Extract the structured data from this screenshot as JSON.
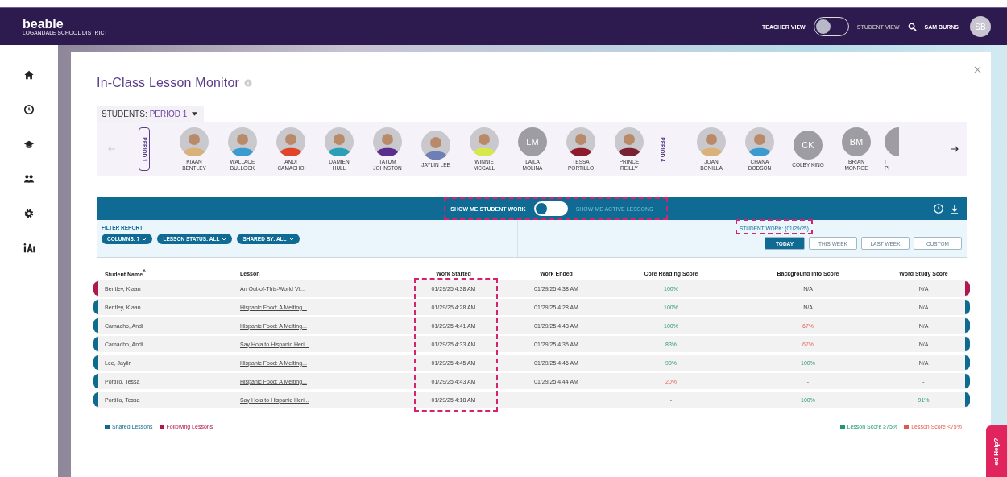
{
  "header": {
    "logo": "beable",
    "district": "LOGANDALE SCHOOL DISTRICT",
    "view_toggle": {
      "left_label": "TEACHER VIEW",
      "right_label": "STUDENT VIEW",
      "on": false
    },
    "user": {
      "name": "SAM BURNS",
      "initials": "SB"
    }
  },
  "sidebar": {
    "items": [
      {
        "kind": "home",
        "selected": false
      },
      {
        "kind": "clock",
        "selected": false
      },
      {
        "kind": "cap",
        "selected": false
      },
      {
        "kind": "people",
        "selected": false
      },
      {
        "kind": "gear",
        "selected": false
      },
      {
        "kind": "ai",
        "selected": false
      }
    ]
  },
  "monitor": {
    "title": "In-Class Lesson Monitor",
    "students_label": "STUDENTS:",
    "period": "PERIOD 1",
    "roster": [
      {
        "kind": "period",
        "label": "PERIOD 1"
      },
      {
        "kind": "avatar",
        "first": "KIAAN",
        "last": "BENTLEY"
      },
      {
        "kind": "avatar",
        "first": "WALLACE",
        "last": "BULLOCK"
      },
      {
        "kind": "avatar",
        "first": "ANDI",
        "last": "CAMACHO"
      },
      {
        "kind": "avatar",
        "first": "DAMIEN",
        "last": "HULL"
      },
      {
        "kind": "avatar",
        "first": "TATUM",
        "last": "JOHNSTON"
      },
      {
        "kind": "avatar",
        "first": "JAYLIN LEE"
      },
      {
        "kind": "avatar",
        "first": "WINNIE",
        "last": "MCCALL"
      },
      {
        "kind": "initials",
        "initials": "LM",
        "first": "LAILA",
        "last": "MOLINA"
      },
      {
        "kind": "avatar",
        "first": "TESSA",
        "last": "PORTILLO"
      },
      {
        "kind": "avatar",
        "first": "PRINCE",
        "last": "REILLY"
      },
      {
        "kind": "period",
        "label": "PERIOD 4"
      },
      {
        "kind": "avatar",
        "first": "JOAN",
        "last": "BONILLA"
      },
      {
        "kind": "avatar",
        "first": "CHANA",
        "last": "DODSON"
      },
      {
        "kind": "initials",
        "initials": "CK",
        "first": "COLBY KING"
      },
      {
        "kind": "initials",
        "initials": "BM",
        "first": "BRIAN",
        "last": "MONROE"
      },
      {
        "kind": "partial",
        "first": "I",
        "last": "PI"
      }
    ],
    "mode_toggle": {
      "left_label": "SHOW ME STUDENT WORK",
      "right_label": "SHOW ME ACTIVE LESSONS",
      "on": false
    },
    "filter_label": "FILTER REPORT",
    "filters": [
      "COLUMNS: 7",
      "LESSON STATUS: ALL",
      "SHARED BY: ALL"
    ],
    "date_label": "STUDENT WORK: (01/29/25)",
    "ranges": [
      {
        "label": "TODAY",
        "selected": true
      },
      {
        "label": "THIS WEEK",
        "selected": false
      },
      {
        "label": "LAST WEEK",
        "selected": false
      },
      {
        "label": "CUSTOM",
        "selected": false
      }
    ],
    "table": {
      "columns": [
        "Student Name",
        "Lesson",
        "Work Started",
        "Work Ended",
        "Core Reading Score",
        "Background Info Score",
        "Word Study Score"
      ],
      "sort_indicator": "^",
      "rows": [
        {
          "kind": "following",
          "cells": [
            "Bentley, Kiaan",
            "An Out-of-This-World Vi...",
            "01/29/25 4:38 AM",
            "01/29/25 4:38 AM"
          ],
          "scores": [
            {
              "text": "100%",
              "kind": "pass"
            },
            {
              "text": "N/A",
              "kind": "none"
            },
            {
              "text": "N/A",
              "kind": "none"
            }
          ]
        },
        {
          "kind": "shared",
          "cells": [
            "Bentley, Kiaan",
            "Hispanic Food: A Melting...",
            "01/29/25 4:28 AM",
            "01/29/25 4:28 AM"
          ],
          "scores": [
            {
              "text": "100%",
              "kind": "pass"
            },
            {
              "text": "N/A",
              "kind": "none"
            },
            {
              "text": "N/A",
              "kind": "none"
            }
          ]
        },
        {
          "kind": "shared",
          "cells": [
            "Camacho, Andi",
            "Hispanic Food: A Melting...",
            "01/29/25 4:41 AM",
            "01/29/25 4:43 AM"
          ],
          "scores": [
            {
              "text": "100%",
              "kind": "pass"
            },
            {
              "text": "67%",
              "kind": "fail"
            },
            {
              "text": "N/A",
              "kind": "none"
            }
          ]
        },
        {
          "kind": "shared",
          "cells": [
            "Camacho, Andi",
            "Say Hola to Hispanic Heri...",
            "01/29/25 4:33 AM",
            "01/29/25 4:35 AM"
          ],
          "scores": [
            {
              "text": "83%",
              "kind": "pass"
            },
            {
              "text": "67%",
              "kind": "fail"
            },
            {
              "text": "N/A",
              "kind": "none"
            }
          ]
        },
        {
          "kind": "shared",
          "cells": [
            "Lee, Jaylin",
            "Hispanic Food: A Melting...",
            "01/29/25 4:45 AM",
            "01/29/25 4:46 AM"
          ],
          "scores": [
            {
              "text": "90%",
              "kind": "pass"
            },
            {
              "text": "100%",
              "kind": "pass"
            },
            {
              "text": "N/A",
              "kind": "none"
            }
          ]
        },
        {
          "kind": "shared",
          "cells": [
            "Portillo, Tessa",
            "Hispanic Food: A Melting...",
            "01/29/25 4:43 AM",
            "01/29/25 4:44 AM"
          ],
          "scores": [
            {
              "text": "20%",
              "kind": "fail"
            },
            {
              "text": "-",
              "kind": "none"
            },
            {
              "text": "-",
              "kind": "none"
            }
          ]
        },
        {
          "kind": "shared",
          "cells": [
            "Portillo, Tessa",
            "Say Hola to Hispanic Heri...",
            "01/29/25 4:18 AM",
            ""
          ],
          "scores": [
            {
              "text": "-",
              "kind": "none"
            },
            {
              "text": "100%",
              "kind": "pass"
            },
            {
              "text": "91%",
              "kind": "pass"
            }
          ]
        }
      ]
    },
    "legend_left": [
      {
        "label": "Shared Lessons",
        "color": "#0e6a8e"
      },
      {
        "label": "Following Lessons",
        "color": "#b0174a"
      }
    ],
    "legend_right": [
      {
        "label": "Lesson Score ≥75%",
        "color": "#1e9a6a"
      },
      {
        "label": "Lesson Score <75%",
        "color": "#e8554e"
      }
    ]
  },
  "help_tab": "ed Help?"
}
